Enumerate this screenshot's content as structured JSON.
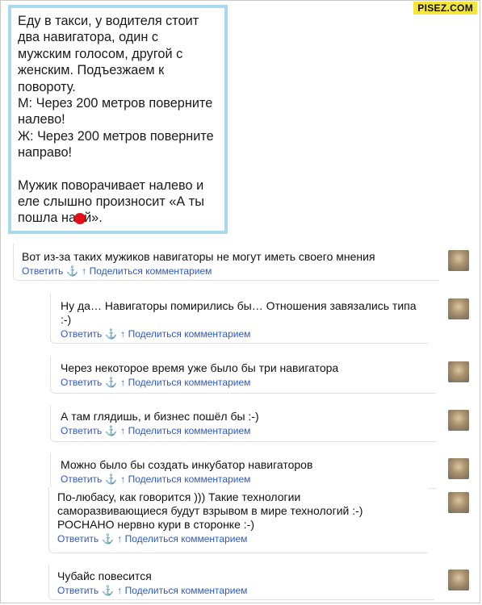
{
  "watermark": "PISEZ.COM",
  "post": {
    "lines": [
      "Еду в такси, у водителя стоит",
      "два навигатора, один с",
      "мужским голосом, другой с",
      "женским. Подъезжаем к",
      "повороту.",
      "М: Через 200 метров поверните",
      "налево!",
      "Ж: Через 200 метров поверните",
      "направо!"
    ],
    "closing_lines": [
      "Мужик поворачивает налево и",
      "еле слышно произносит «А ты"
    ],
    "last_line_before": "пошла на",
    "last_line_after": "й»."
  },
  "actions": {
    "reply": "Ответить",
    "anchor": "⚓",
    "up": "↑",
    "share": "Поделиться комментарием"
  },
  "comments": [
    {
      "text": "Вот из-за таких мужиков навигаторы не могут иметь своего мнения"
    },
    {
      "text": "Ну да… Навигаторы помирились бы… Отношения завязались типа :-)"
    },
    {
      "text": "Через некоторое время уже было бы три навигатора"
    },
    {
      "text": "А там глядишь, и бизнес пошёл бы :-)"
    },
    {
      "text": "Можно было бы создать инкубатор навигаторов"
    },
    {
      "text": "По-любасу, как говорится ))) Такие технологии саморазвивающиеся будут взрывом в мире технологий :-) РОСНАНО нервно кури в сторонке :-)"
    },
    {
      "text": "Чубайс повесится"
    }
  ]
}
